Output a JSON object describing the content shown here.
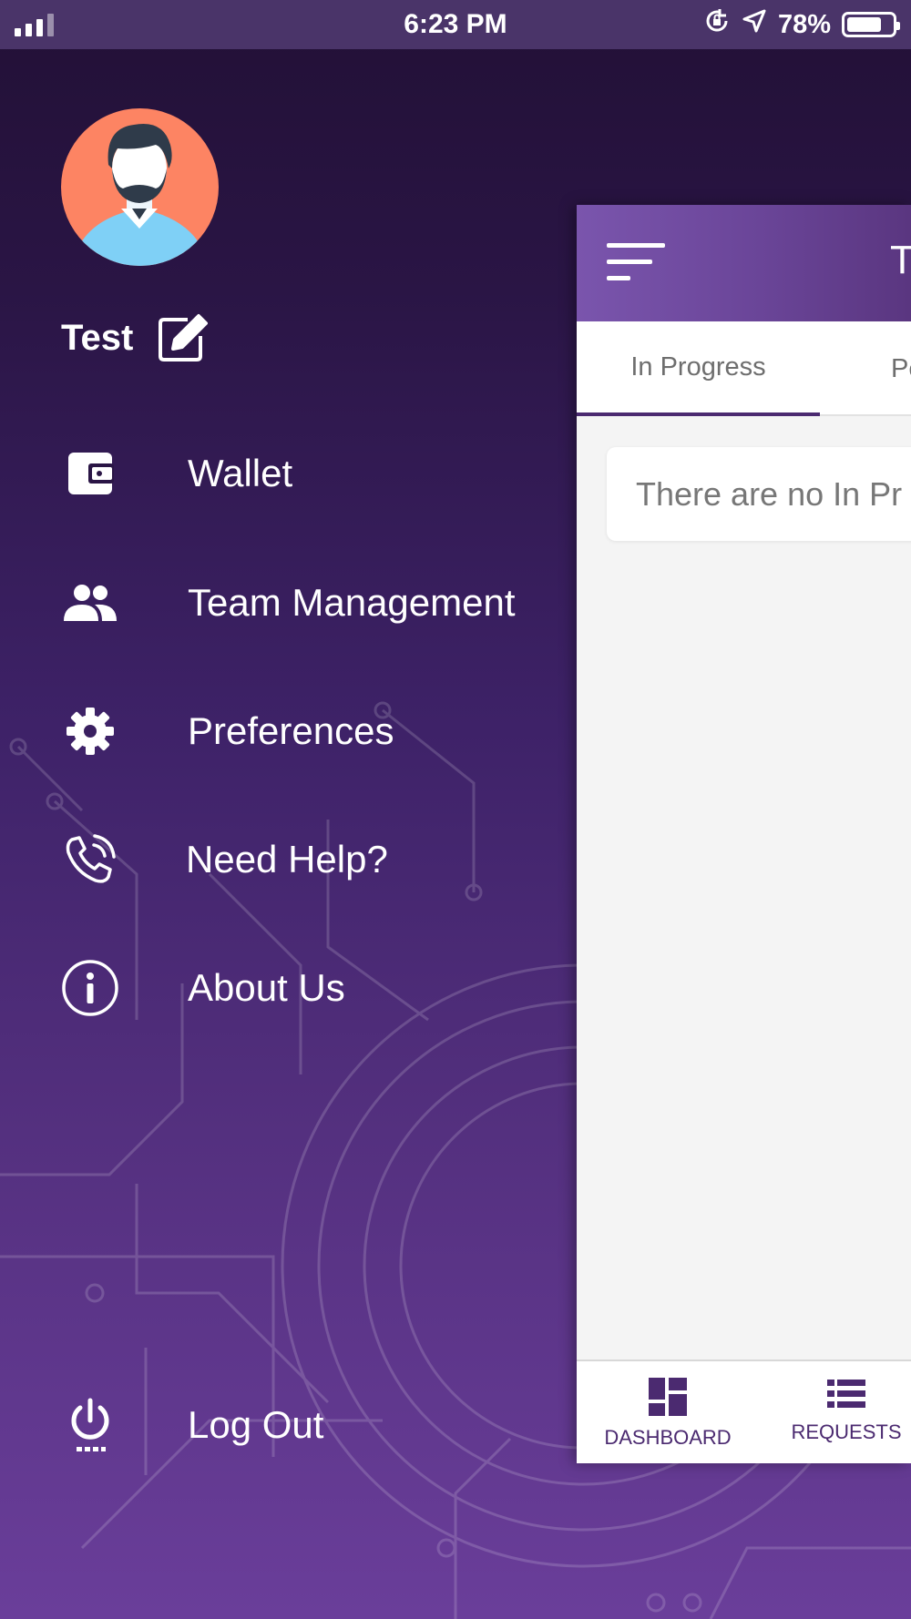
{
  "status_bar": {
    "time": "6:23 PM",
    "battery_percent": "78%",
    "battery_level": 0.78,
    "signal_bars": 4,
    "signal_filled": 3,
    "icons": [
      "signal-icon",
      "rotation-lock-icon",
      "location-arrow-icon",
      "battery-icon"
    ]
  },
  "drawer": {
    "user": {
      "name": "Test",
      "avatar_icon": "avatar-icon",
      "edit_icon": "edit-icon"
    },
    "menu": [
      {
        "id": "wallet",
        "label": "Wallet",
        "icon": "wallet-icon"
      },
      {
        "id": "team-management",
        "label": "Team Management",
        "icon": "people-icon"
      },
      {
        "id": "preferences",
        "label": "Preferences",
        "icon": "gear-icon"
      },
      {
        "id": "need-help",
        "label": "Need Help?",
        "icon": "phone-icon"
      },
      {
        "id": "about-us",
        "label": "About Us",
        "icon": "info-icon"
      }
    ],
    "logout": {
      "label": "Log Out",
      "icon": "power-icon"
    }
  },
  "main": {
    "header": {
      "title": "T",
      "menu_icon": "hamburger-icon"
    },
    "tabs": [
      {
        "label": "In Progress",
        "active": true
      },
      {
        "label": "Pe",
        "active": false
      }
    ],
    "empty_message": "There are no In Pr",
    "bottom_nav": [
      {
        "label": "DASHBOARD",
        "icon": "dashboard-icon"
      },
      {
        "label": "REQUESTS",
        "icon": "list-icon"
      }
    ]
  },
  "colors": {
    "drawer_top": "#221036",
    "drawer_bottom": "#6a3e9a",
    "status_bar": "#4a3469",
    "header": "#7a55ad",
    "accent": "#4b2a70",
    "avatar_bg": "#fd8463"
  }
}
